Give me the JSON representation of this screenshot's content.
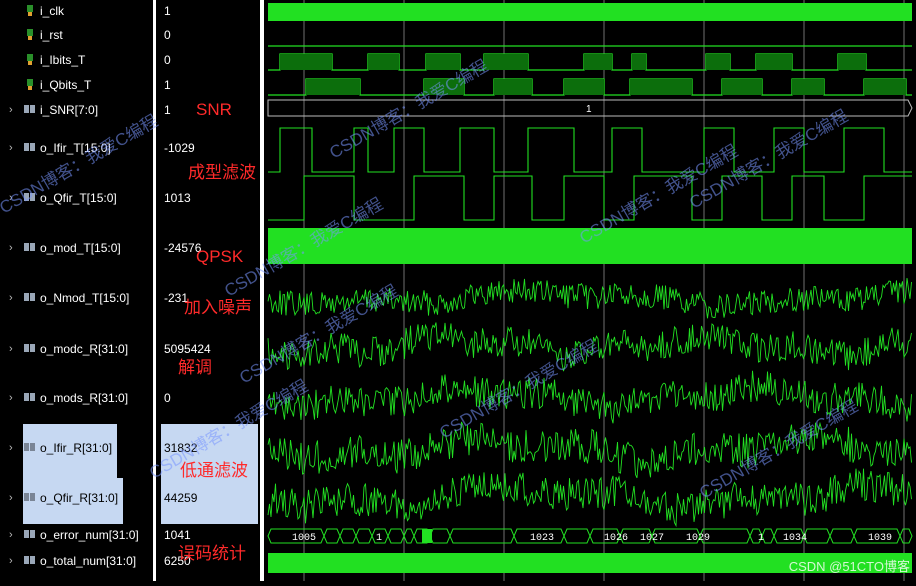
{
  "signals": [
    {
      "name": "i_clk",
      "value": "1",
      "icon": "bit-signal-icon",
      "expand": false
    },
    {
      "name": "i_rst",
      "value": "0",
      "icon": "bit-signal-icon",
      "expand": false
    },
    {
      "name": "i_Ibits_T",
      "value": "0",
      "icon": "bit-signal-icon",
      "expand": false
    },
    {
      "name": "i_Qbits_T",
      "value": "1",
      "icon": "bit-signal-icon",
      "expand": false
    },
    {
      "name": "i_SNR[7:0]",
      "value": "1",
      "icon": "bus-signal-icon",
      "expand": true
    },
    {
      "name": "o_Ifir_T[15:0]",
      "value": "-1029",
      "icon": "bus-signal-icon",
      "expand": true
    },
    {
      "name": "o_Qfir_T[15:0]",
      "value": "1013",
      "icon": "bus-signal-icon",
      "expand": true
    },
    {
      "name": "o_mod_T[15:0]",
      "value": "-24576",
      "icon": "bus-signal-icon",
      "expand": true
    },
    {
      "name": "o_Nmod_T[15:0]",
      "value": "-231",
      "icon": "bus-signal-icon",
      "expand": true
    },
    {
      "name": "o_modc_R[31:0]",
      "value": "5095424",
      "icon": "bus-signal-icon",
      "expand": true
    },
    {
      "name": "o_mods_R[31:0]",
      "value": "0",
      "icon": "bus-signal-icon",
      "expand": true
    },
    {
      "name": "o_Ifir_R[31:0]",
      "value": "31832",
      "icon": "bus-signal-icon",
      "expand": true
    },
    {
      "name": "o_Qfir_R[31:0]",
      "value": "44259",
      "icon": "bus-signal-icon",
      "expand": true
    },
    {
      "name": "o_error_num[31:0]",
      "value": "1041",
      "icon": "bus-signal-icon",
      "expand": true
    },
    {
      "name": "o_total_num[31:0]",
      "value": "6250",
      "icon": "bus-signal-icon",
      "expand": true
    }
  ],
  "annotations": [
    "SNR",
    "成型滤波",
    "QPSK",
    "加入噪声",
    "解调",
    "低通滤波",
    "误码统计"
  ],
  "waveform_labels": {
    "snr_bus": "1",
    "error_bus": [
      "1005",
      "1",
      "1023",
      "1026",
      "1027",
      "1029",
      "1",
      "1034",
      "1039"
    ]
  },
  "watermarks": [
    "CSDN博客：我爱C编程",
    "CSDN博客：我爱C编程",
    "CSDN博客：我爱C编程",
    "CSDN博客：我爱C编程",
    "CSDN博客：我爱C编程",
    "CSDN博客：我爱C编程",
    "CSDN博客：我爱C编程",
    "CSDN博客：我爱C编程",
    "CSDN博客：我爱C编程"
  ],
  "credit": "CSDN @51CTO博客",
  "colors": {
    "wave": "#22e022",
    "background": "#000000",
    "annotation": "#ff2a2a",
    "highlight": "#c6d8f2"
  }
}
